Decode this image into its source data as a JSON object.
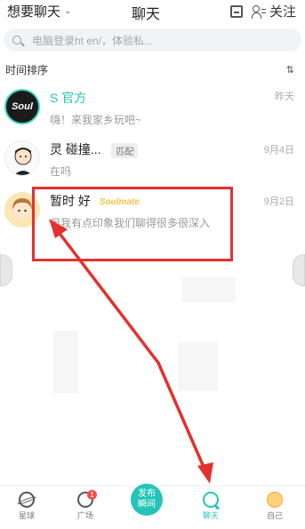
{
  "header": {
    "left_label": "想要聊天",
    "title": "聊天",
    "follow_label": "关注"
  },
  "search": {
    "placeholder": "电脑登录ht                                  en/，体验私..."
  },
  "sort": {
    "label": "时间排序"
  },
  "chats": [
    {
      "name": "S   官方",
      "time": "昨天",
      "message": "嗨！来我家乡玩吧~",
      "avatar_text": "Soul"
    },
    {
      "name": "灵    碰撞...",
      "badge": "匹配",
      "time": "9月4日",
      "message": "在吗"
    },
    {
      "name": "暂时    好",
      "tag": "Soulmate",
      "time": "9月2日",
      "message": "但我有点印象我们聊得很多很深入"
    }
  ],
  "bottom_nav": {
    "tabs": [
      {
        "label": "星球"
      },
      {
        "label": "广场",
        "badge": "1"
      },
      {
        "label": "聊天"
      },
      {
        "label": "自己"
      }
    ],
    "publish_line1": "发布",
    "publish_line2": "瞬间"
  },
  "colors": {
    "accent": "#25c4b8",
    "annotation": "#e53030",
    "badge": "#f05050"
  }
}
